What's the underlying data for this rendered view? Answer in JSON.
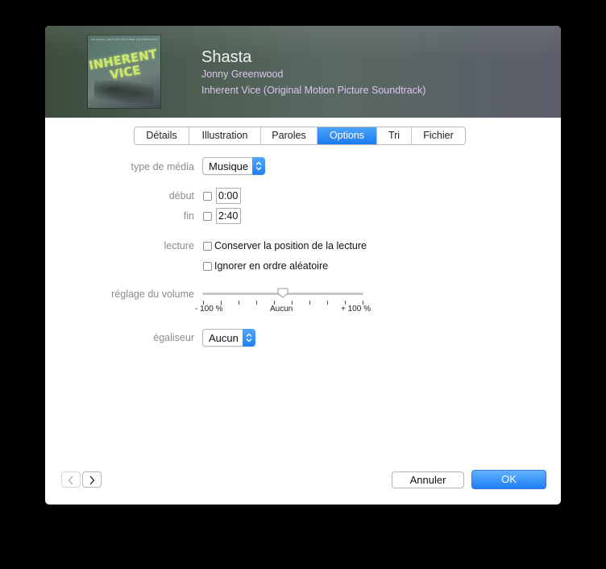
{
  "track": {
    "title": "Shasta",
    "artist": "Jonny Greenwood",
    "album": "Inherent Vice (Original Motion Picture Soundtrack)"
  },
  "artwork": {
    "title_line1": "INHERENT",
    "title_line2": "VICE",
    "small_text": "ORIGINAL MOTION PICTURE SOUNDTRACK"
  },
  "tabs": [
    {
      "label": "Détails"
    },
    {
      "label": "Illustration"
    },
    {
      "label": "Paroles"
    },
    {
      "label": "Options",
      "active": true
    },
    {
      "label": "Tri"
    },
    {
      "label": "Fichier"
    }
  ],
  "options": {
    "media_type_label": "type de média",
    "media_type_value": "Musique",
    "start_label": "début",
    "start_checked": false,
    "start_value": "0:00",
    "stop_label": "fin",
    "stop_checked": false,
    "stop_value": "2:40",
    "playback_label": "lecture",
    "remember_position_label": "Conserver la position de la lecture",
    "remember_position_checked": false,
    "skip_shuffle_label": "Ignorer en ordre aléatoire",
    "skip_shuffle_checked": false,
    "volume_label": "réglage du volume",
    "volume_value_percent": 0,
    "volume_min_label": "- 100 %",
    "volume_mid_label": "Aucun",
    "volume_max_label": "+ 100 %",
    "equalizer_label": "égaliseur",
    "equalizer_value": "Aucun"
  },
  "footer": {
    "cancel_label": "Annuler",
    "ok_label": "OK"
  },
  "colors": {
    "accent": "#1d7cf2",
    "label_gray": "#8b8b8b",
    "artist_text": "#d9c8f0"
  }
}
